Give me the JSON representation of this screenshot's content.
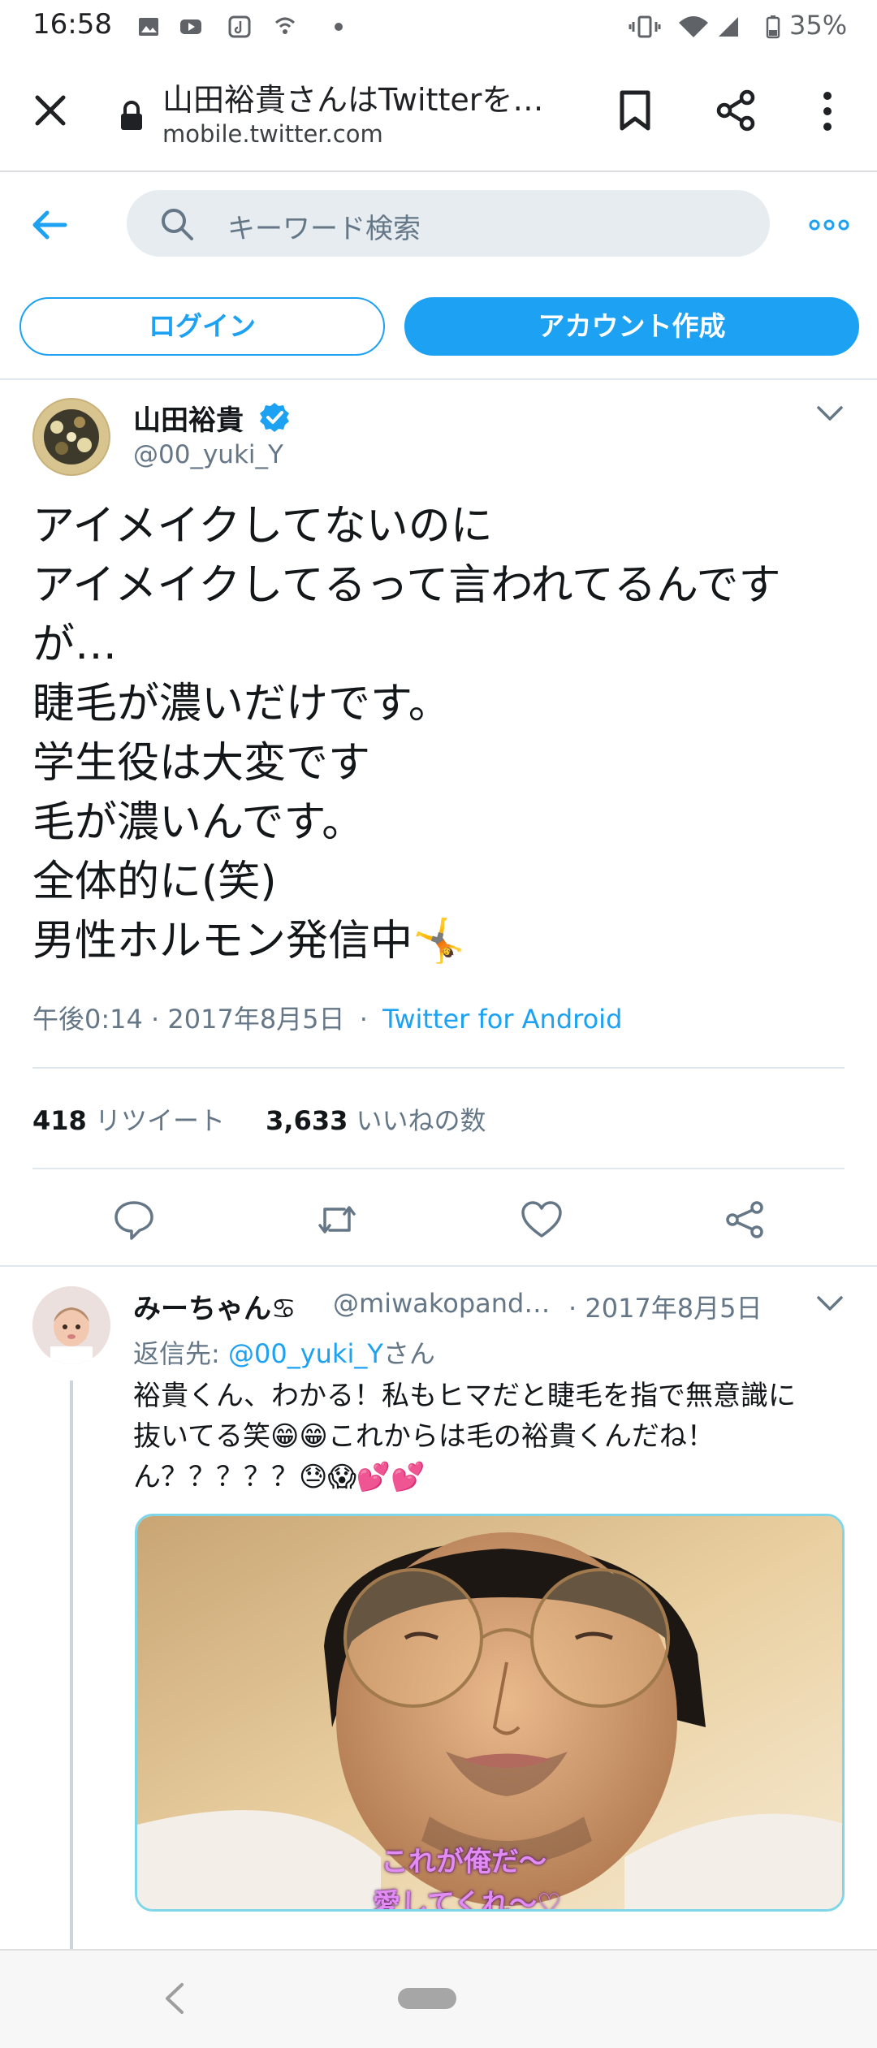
{
  "status_bar": {
    "time": "16:58",
    "battery": "35%"
  },
  "browser": {
    "page_title": "山田裕貴さんはTwitterを…",
    "url": "mobile.twitter.com"
  },
  "search": {
    "placeholder": "キーワード検索"
  },
  "auth": {
    "login_label": "ログイン",
    "signup_label": "アカウント作成"
  },
  "tweet": {
    "author_name": "山田裕貴",
    "handle": "@00_yuki_Y",
    "verified": true,
    "text": "アイメイクしてないのに\nアイメイクしてるって言われてるんです\nが…\n睫毛が濃いだけです。\n学生役は大変です\n毛が濃いんです。\n全体的に(笑)\n男性ホルモン発信中🤸",
    "time": "午後0:14 · 2017年8月5日",
    "separator": "·",
    "source": "Twitter for Android",
    "retweets_count": "418",
    "retweets_label": "リツイート",
    "likes_count": "3,633",
    "likes_label": "いいねの数"
  },
  "reply": {
    "author_name": "みーちゃん♋",
    "handle": "@miwakopand…",
    "date": "· 2017年8月5日",
    "reply_to_prefix": "返信先: ",
    "reply_to_handle": "@00_yuki_Y",
    "reply_to_suffix": "さん",
    "text": "裕貴くん、わかる！私もヒマだと睫毛を指で無意識に\n抜いてる笑😁😁これからは毛の裕貴くんだね！\nん？？？？？😓😱💕💕",
    "image_caption_line1": "これが俺だ〜",
    "image_caption_line2": "愛してくれ〜♡"
  },
  "colors": {
    "brand": "#1da1f2",
    "secondary_text": "#657786",
    "verified": "#1da1f2"
  },
  "icons": [
    "close-icon",
    "lock-icon",
    "bookmark-icon",
    "share-icon",
    "more-vert-icon",
    "back-arrow-icon",
    "search-icon",
    "more-horiz-icon",
    "verified-icon",
    "chevron-down-icon",
    "reply-icon",
    "retweet-icon",
    "like-icon",
    "share-tweet-icon",
    "nav-back-icon",
    "home-pill-icon"
  ]
}
